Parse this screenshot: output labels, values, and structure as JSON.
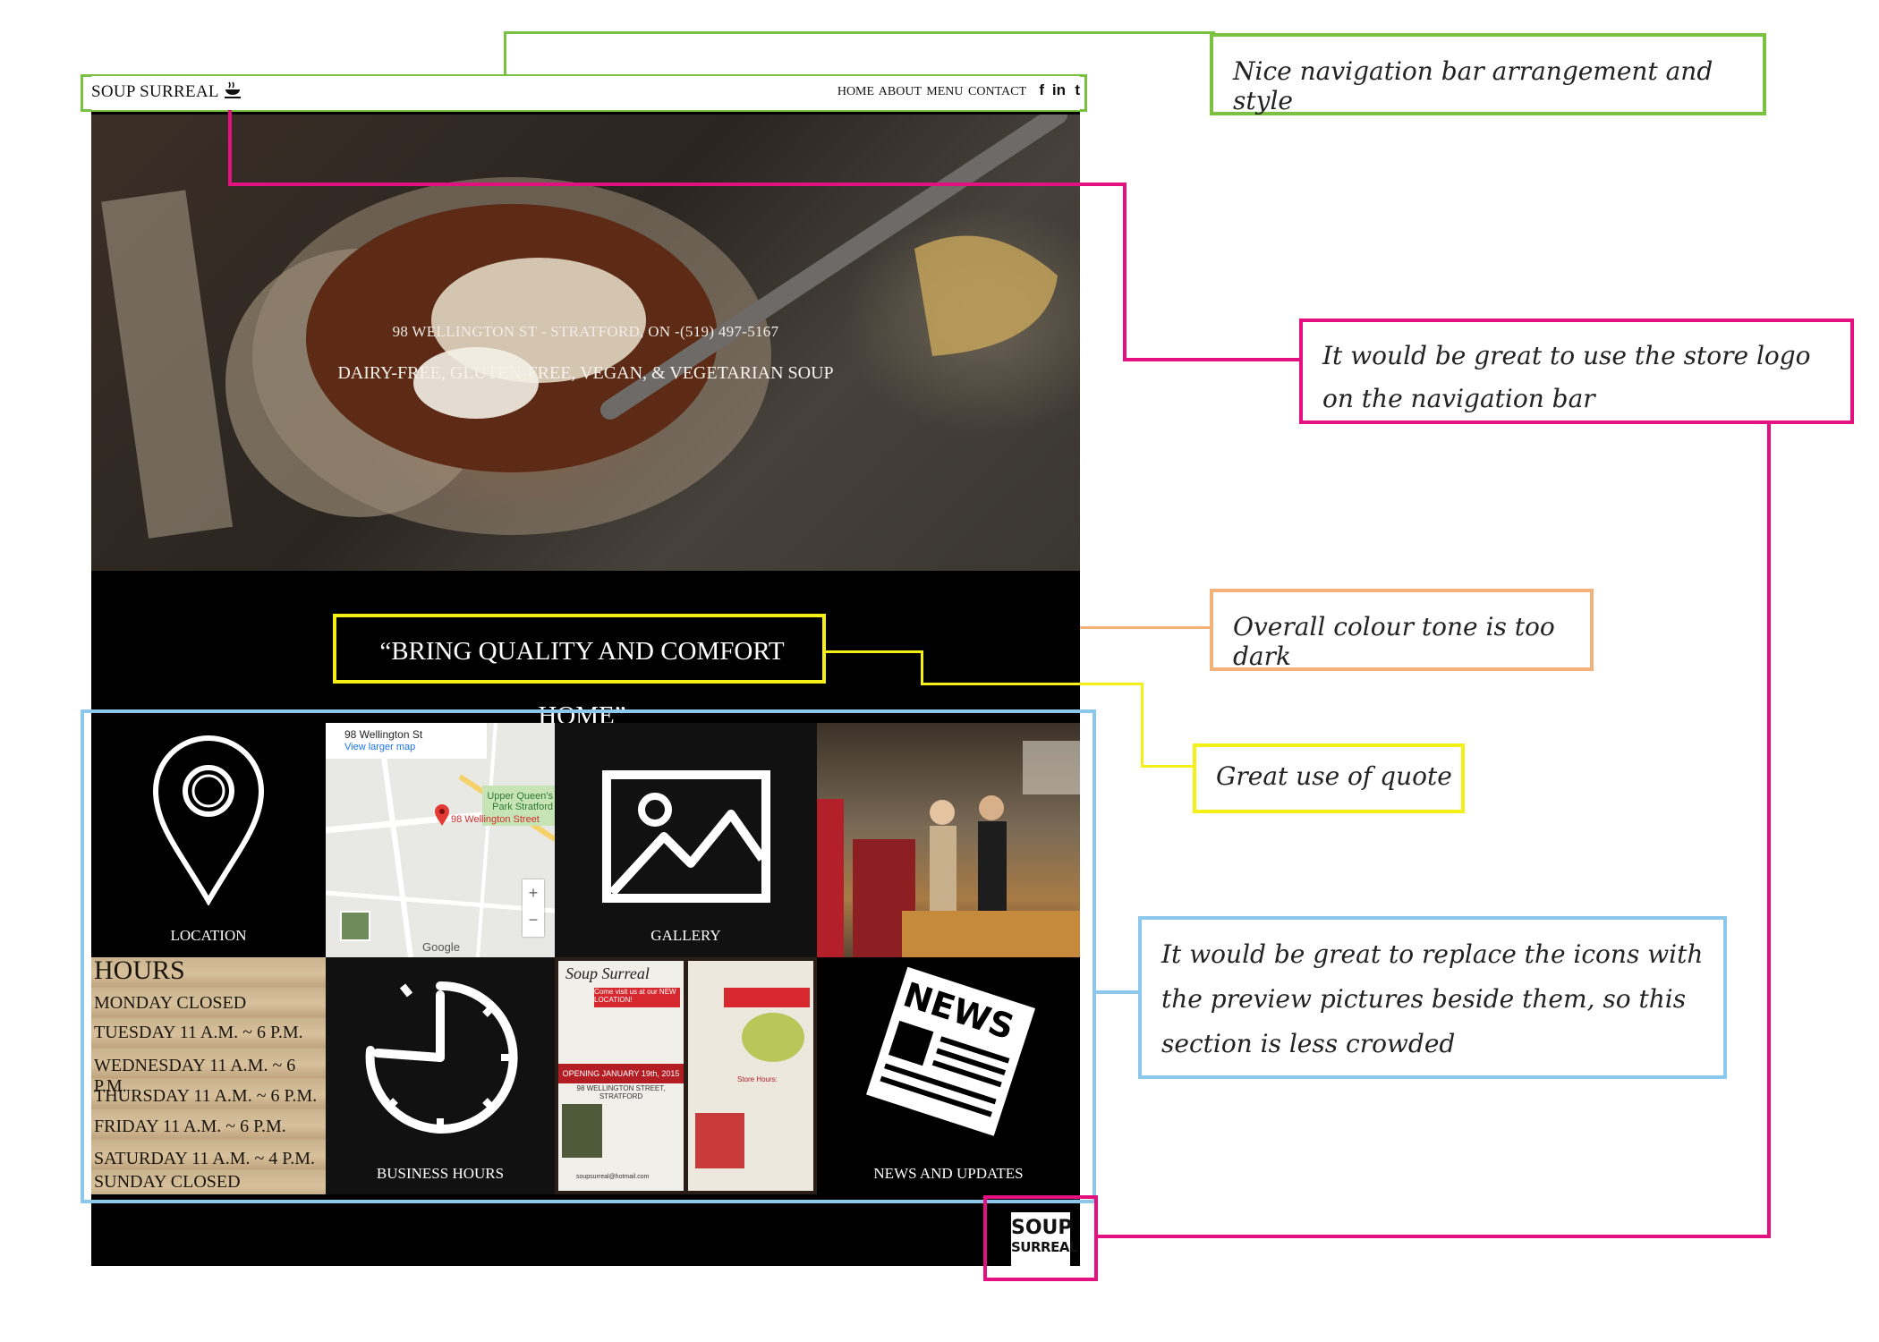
{
  "site": {
    "brand": "SOUP SURREAL",
    "nav": [
      "HOME",
      "ABOUT",
      "MENU",
      "CONTACT"
    ],
    "social": {
      "facebook": "f",
      "linkedin": "in",
      "twitter": "t"
    },
    "hero": {
      "address": "98 WELLINGTON ST - STRATFORD, ON -(519) 497-5167",
      "tagline": "DAIRY-FREE, GLUTEN-FREE, VEGAN, & VEGETARIAN SOUP"
    },
    "quote": "“BRING QUALITY AND COMFORT HOME”",
    "tiles": {
      "location": "LOCATION",
      "gallery": "GALLERY",
      "business_hours": "BUSINESS HOURS",
      "news": "NEWS AND UPDATES"
    },
    "map": {
      "title": "98 Wellington St",
      "link": "View larger map",
      "park": "Upper Queen's Park Stratford",
      "pin_label": "98 Wellington Street",
      "google": "Google"
    },
    "hours": {
      "heading": "HOURS",
      "lines": [
        "MONDAY CLOSED",
        "TUESDAY 11 A.M. ~ 6 P.M.",
        "WEDNESDAY 11 A.M. ~ 6 P.M.",
        "THURSDAY 11 A.M. ~ 6 P.M.",
        "FRIDAY 11 A.M. ~ 6 P.M.",
        "SATURDAY 11 A.M. ~ 4 P.M.",
        "SUNDAY CLOSED"
      ]
    },
    "flyer": {
      "brand": "Soup Surreal",
      "banner": "Come visit us at our NEW LOCATION!",
      "opening": "OPENING JANUARY 19th, 2015",
      "street": "98 WELLINGTON STREET, STRATFORD",
      "store_hours": "Store Hours:",
      "email": "soupsurreal@hotmail.com"
    },
    "news_word": "NEWS",
    "footer_logo": [
      "SOUP",
      "SURREAL"
    ]
  },
  "annotations": {
    "nav": "Nice navigation bar arrangement and style",
    "logo": "It would be great to use the store logo on the navigation bar",
    "tone": "Overall colour tone is too dark",
    "quote": "Great use of quote",
    "icons": "It would be great to replace the icons with the preview pictures beside them, so this section is less crowded"
  },
  "colors": {
    "green": "#7ac142",
    "magenta": "#e3117f",
    "orange": "#f2b27a",
    "yellow": "#f5ef18",
    "blue": "#8cc8ec"
  }
}
